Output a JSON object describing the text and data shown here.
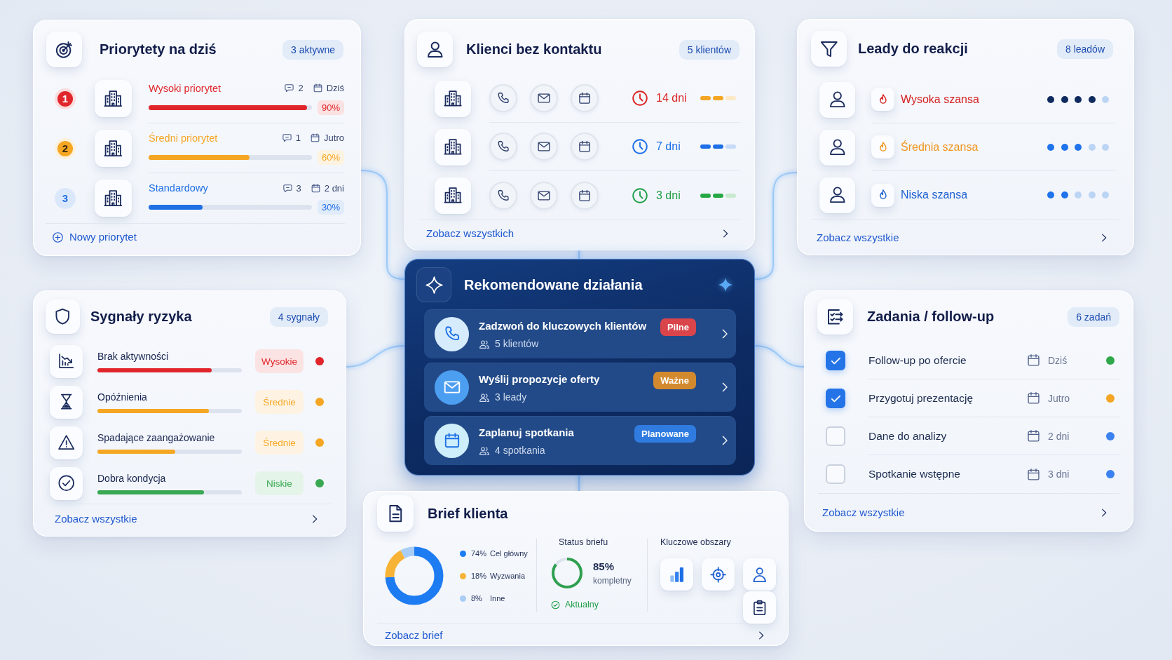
{
  "priorities": {
    "title": "Priorytety na dziś",
    "badge": "3 aktywne",
    "items": [
      {
        "rank": "1",
        "kind": "high",
        "label": "Wysoki priorytet",
        "color": "#e0262b",
        "comments": "2",
        "due": "Dziś",
        "level": 0.97,
        "percent": "90%"
      },
      {
        "rank": "2",
        "kind": "medium",
        "label": "Średni priorytet",
        "color": "#f5a623",
        "comments": "1",
        "due": "Jutro",
        "level": 0.62,
        "percent": "60%"
      },
      {
        "rank": "3",
        "kind": "standard",
        "label": "Standardowy",
        "color": "#1f6fe5",
        "comments": "3",
        "due": "2 dni",
        "level": 0.33,
        "percent": "30%"
      }
    ],
    "add_link": "Nowy priorytet"
  },
  "clients": {
    "title": "Klienci bez kontaktu",
    "badge": "5 klientów",
    "rows": [
      {
        "days": "14 dni",
        "color": "#dc2626",
        "bar": {
          "level": 0.67,
          "color": "#f5a524"
        }
      },
      {
        "days": "7 dni",
        "color": "#1d6fe8",
        "bar": {
          "level": 0.67,
          "color": "#1d6fe8"
        }
      },
      {
        "days": "3 dni",
        "color": "#22a04b",
        "bar": {
          "level": 0.67,
          "color": "#27a844"
        }
      }
    ],
    "link": "Zobacz wszystkich"
  },
  "leads": {
    "title": "Leady do reakcji",
    "badge": "8 leadów",
    "items": [
      {
        "label": "Wysoka szansa",
        "color": "#d42020",
        "rating": {
          "stars": 4,
          "color": "#0f2a5e"
        }
      },
      {
        "label": "Średnia szansa",
        "color": "#f0951f",
        "rating": {
          "stars": 3,
          "color": "#1f74ec"
        }
      },
      {
        "label": "Niska szansa",
        "color": "#1d5fd1",
        "rating": {
          "stars": 2,
          "color": "#1f74ec"
        }
      }
    ],
    "link": "Zobacz wszystkie"
  },
  "risks": {
    "title": "Sygnały ryzyka",
    "badge": "4 sygnały",
    "items": [
      {
        "kind": "inactivity",
        "label": "Brak aktywności",
        "level": 0.79,
        "severity": "Wysokie",
        "color": "#e0262b"
      },
      {
        "kind": "delay",
        "label": "Opóźnienia",
        "level": 0.77,
        "severity": "Średnie",
        "color": "#f5a623"
      },
      {
        "kind": "engagement",
        "label": "Spadające zaangażowanie",
        "level": 0.54,
        "severity": "Średnie",
        "color": "#f5a623"
      },
      {
        "kind": "health",
        "label": "Dobra kondycja",
        "level": 0.74,
        "severity": "Niskie",
        "color": "#38a852"
      }
    ],
    "link": "Zobacz wszystkie"
  },
  "recommendations": {
    "title": "Rekomendowane działania",
    "items": [
      {
        "kind": "call",
        "title": "Zadzwoń do kluczowych klientów",
        "meta": "5 klientów",
        "tag": "Pilne",
        "color": "#d9454b"
      },
      {
        "kind": "mail",
        "title": "Wyślij propozycje oferty",
        "meta": "3 leady",
        "tag": "Ważne",
        "color": "#d38a2e"
      },
      {
        "kind": "meeting",
        "title": "Zaplanuj spotkania",
        "meta": "4 spotkania",
        "tag": "Planowane",
        "color": "#2f7be0"
      }
    ]
  },
  "tasks": {
    "title": "Zadania / follow-up",
    "badge": "6 zadań",
    "items": [
      {
        "label": "Follow-up po ofercie",
        "checked": true,
        "due": "Dziś",
        "color": "#2fa84a"
      },
      {
        "label": "Przygotuj prezentację",
        "checked": true,
        "due": "Jutro",
        "color": "#f5a524"
      },
      {
        "label": "Dane do analizy",
        "checked": false,
        "due": "2 dni",
        "color": "#3b82f0"
      },
      {
        "label": "Spotkanie wstępne",
        "checked": false,
        "due": "3 dni",
        "color": "#3b82f0"
      }
    ],
    "link": "Zobacz wszystkie"
  },
  "brief": {
    "title": "Brief klienta",
    "chart_data": {
      "type": "donut",
      "categories": [
        "Cel główny",
        "Wyzwania",
        "Inne"
      ],
      "values": [
        74,
        18,
        8
      ],
      "value_labels": [
        "74%",
        "18%",
        "8%"
      ],
      "colors": [
        "#1e7cf2",
        "#f7b335",
        "#a9cdf5"
      ]
    },
    "status": {
      "label": "Status briefu",
      "level": 0.85,
      "value": "85%",
      "caption": "kompletny",
      "state": "Aktualny"
    },
    "areas_label": "Kluczowe obszary",
    "link": "Zobacz brief"
  }
}
